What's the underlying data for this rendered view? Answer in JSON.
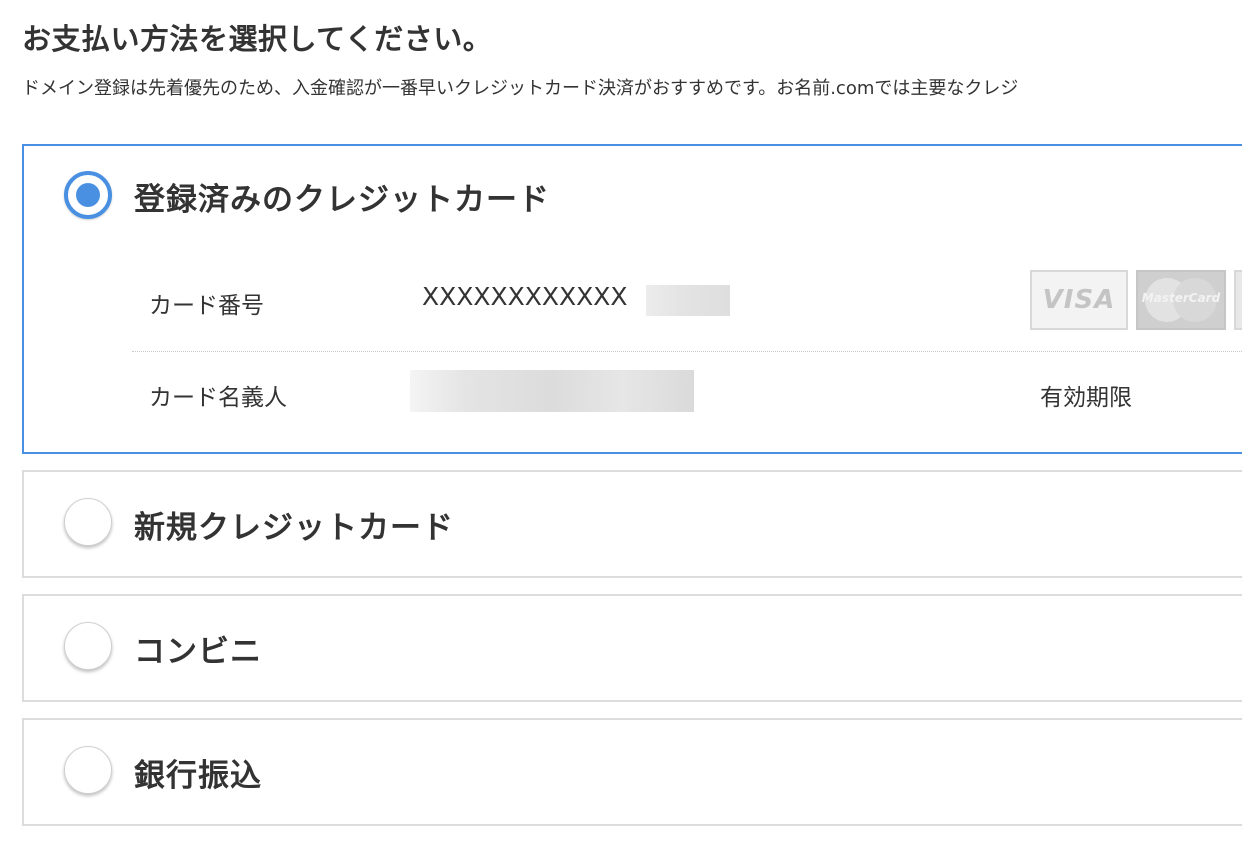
{
  "page": {
    "heading": "お支払い方法を選択してください。",
    "description": "ドメイン登録は先着優先のため、入金確認が一番早いクレジットカード決済がおすすめです。お名前.comでは主要なクレジ"
  },
  "options": [
    {
      "label": "登録済みのクレジットカード",
      "selected": true,
      "details": {
        "card_number_label": "カード番号",
        "card_number_value": "XXXXXXXXXXXX",
        "cardholder_label": "カード名義人",
        "expiry_label": "有効期限",
        "brands": [
          "VISA",
          "MasterCard"
        ]
      }
    },
    {
      "label": "新規クレジットカード",
      "selected": false
    },
    {
      "label": "コンビニ",
      "selected": false
    },
    {
      "label": "銀行振込",
      "selected": false
    }
  ],
  "colors": {
    "accent": "#4a90e2",
    "border": "#dcdcdc",
    "text": "#333333"
  }
}
